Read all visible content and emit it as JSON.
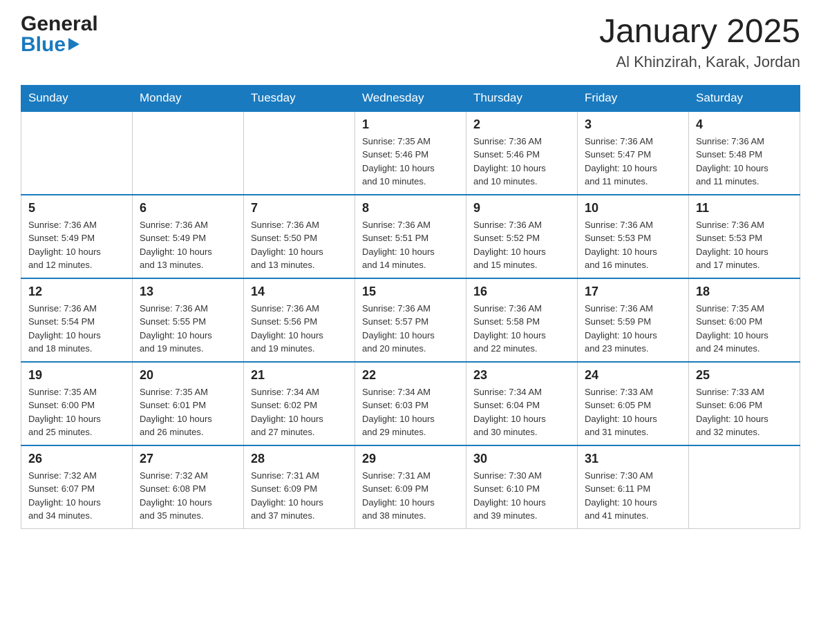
{
  "header": {
    "logo_general": "General",
    "logo_blue": "Blue",
    "title": "January 2025",
    "subtitle": "Al Khinzirah, Karak, Jordan"
  },
  "days_of_week": [
    "Sunday",
    "Monday",
    "Tuesday",
    "Wednesday",
    "Thursday",
    "Friday",
    "Saturday"
  ],
  "weeks": [
    {
      "days": [
        {
          "number": "",
          "info": ""
        },
        {
          "number": "",
          "info": ""
        },
        {
          "number": "",
          "info": ""
        },
        {
          "number": "1",
          "info": "Sunrise: 7:35 AM\nSunset: 5:46 PM\nDaylight: 10 hours\nand 10 minutes."
        },
        {
          "number": "2",
          "info": "Sunrise: 7:36 AM\nSunset: 5:46 PM\nDaylight: 10 hours\nand 10 minutes."
        },
        {
          "number": "3",
          "info": "Sunrise: 7:36 AM\nSunset: 5:47 PM\nDaylight: 10 hours\nand 11 minutes."
        },
        {
          "number": "4",
          "info": "Sunrise: 7:36 AM\nSunset: 5:48 PM\nDaylight: 10 hours\nand 11 minutes."
        }
      ]
    },
    {
      "days": [
        {
          "number": "5",
          "info": "Sunrise: 7:36 AM\nSunset: 5:49 PM\nDaylight: 10 hours\nand 12 minutes."
        },
        {
          "number": "6",
          "info": "Sunrise: 7:36 AM\nSunset: 5:49 PM\nDaylight: 10 hours\nand 13 minutes."
        },
        {
          "number": "7",
          "info": "Sunrise: 7:36 AM\nSunset: 5:50 PM\nDaylight: 10 hours\nand 13 minutes."
        },
        {
          "number": "8",
          "info": "Sunrise: 7:36 AM\nSunset: 5:51 PM\nDaylight: 10 hours\nand 14 minutes."
        },
        {
          "number": "9",
          "info": "Sunrise: 7:36 AM\nSunset: 5:52 PM\nDaylight: 10 hours\nand 15 minutes."
        },
        {
          "number": "10",
          "info": "Sunrise: 7:36 AM\nSunset: 5:53 PM\nDaylight: 10 hours\nand 16 minutes."
        },
        {
          "number": "11",
          "info": "Sunrise: 7:36 AM\nSunset: 5:53 PM\nDaylight: 10 hours\nand 17 minutes."
        }
      ]
    },
    {
      "days": [
        {
          "number": "12",
          "info": "Sunrise: 7:36 AM\nSunset: 5:54 PM\nDaylight: 10 hours\nand 18 minutes."
        },
        {
          "number": "13",
          "info": "Sunrise: 7:36 AM\nSunset: 5:55 PM\nDaylight: 10 hours\nand 19 minutes."
        },
        {
          "number": "14",
          "info": "Sunrise: 7:36 AM\nSunset: 5:56 PM\nDaylight: 10 hours\nand 19 minutes."
        },
        {
          "number": "15",
          "info": "Sunrise: 7:36 AM\nSunset: 5:57 PM\nDaylight: 10 hours\nand 20 minutes."
        },
        {
          "number": "16",
          "info": "Sunrise: 7:36 AM\nSunset: 5:58 PM\nDaylight: 10 hours\nand 22 minutes."
        },
        {
          "number": "17",
          "info": "Sunrise: 7:36 AM\nSunset: 5:59 PM\nDaylight: 10 hours\nand 23 minutes."
        },
        {
          "number": "18",
          "info": "Sunrise: 7:35 AM\nSunset: 6:00 PM\nDaylight: 10 hours\nand 24 minutes."
        }
      ]
    },
    {
      "days": [
        {
          "number": "19",
          "info": "Sunrise: 7:35 AM\nSunset: 6:00 PM\nDaylight: 10 hours\nand 25 minutes."
        },
        {
          "number": "20",
          "info": "Sunrise: 7:35 AM\nSunset: 6:01 PM\nDaylight: 10 hours\nand 26 minutes."
        },
        {
          "number": "21",
          "info": "Sunrise: 7:34 AM\nSunset: 6:02 PM\nDaylight: 10 hours\nand 27 minutes."
        },
        {
          "number": "22",
          "info": "Sunrise: 7:34 AM\nSunset: 6:03 PM\nDaylight: 10 hours\nand 29 minutes."
        },
        {
          "number": "23",
          "info": "Sunrise: 7:34 AM\nSunset: 6:04 PM\nDaylight: 10 hours\nand 30 minutes."
        },
        {
          "number": "24",
          "info": "Sunrise: 7:33 AM\nSunset: 6:05 PM\nDaylight: 10 hours\nand 31 minutes."
        },
        {
          "number": "25",
          "info": "Sunrise: 7:33 AM\nSunset: 6:06 PM\nDaylight: 10 hours\nand 32 minutes."
        }
      ]
    },
    {
      "days": [
        {
          "number": "26",
          "info": "Sunrise: 7:32 AM\nSunset: 6:07 PM\nDaylight: 10 hours\nand 34 minutes."
        },
        {
          "number": "27",
          "info": "Sunrise: 7:32 AM\nSunset: 6:08 PM\nDaylight: 10 hours\nand 35 minutes."
        },
        {
          "number": "28",
          "info": "Sunrise: 7:31 AM\nSunset: 6:09 PM\nDaylight: 10 hours\nand 37 minutes."
        },
        {
          "number": "29",
          "info": "Sunrise: 7:31 AM\nSunset: 6:09 PM\nDaylight: 10 hours\nand 38 minutes."
        },
        {
          "number": "30",
          "info": "Sunrise: 7:30 AM\nSunset: 6:10 PM\nDaylight: 10 hours\nand 39 minutes."
        },
        {
          "number": "31",
          "info": "Sunrise: 7:30 AM\nSunset: 6:11 PM\nDaylight: 10 hours\nand 41 minutes."
        },
        {
          "number": "",
          "info": ""
        }
      ]
    }
  ]
}
